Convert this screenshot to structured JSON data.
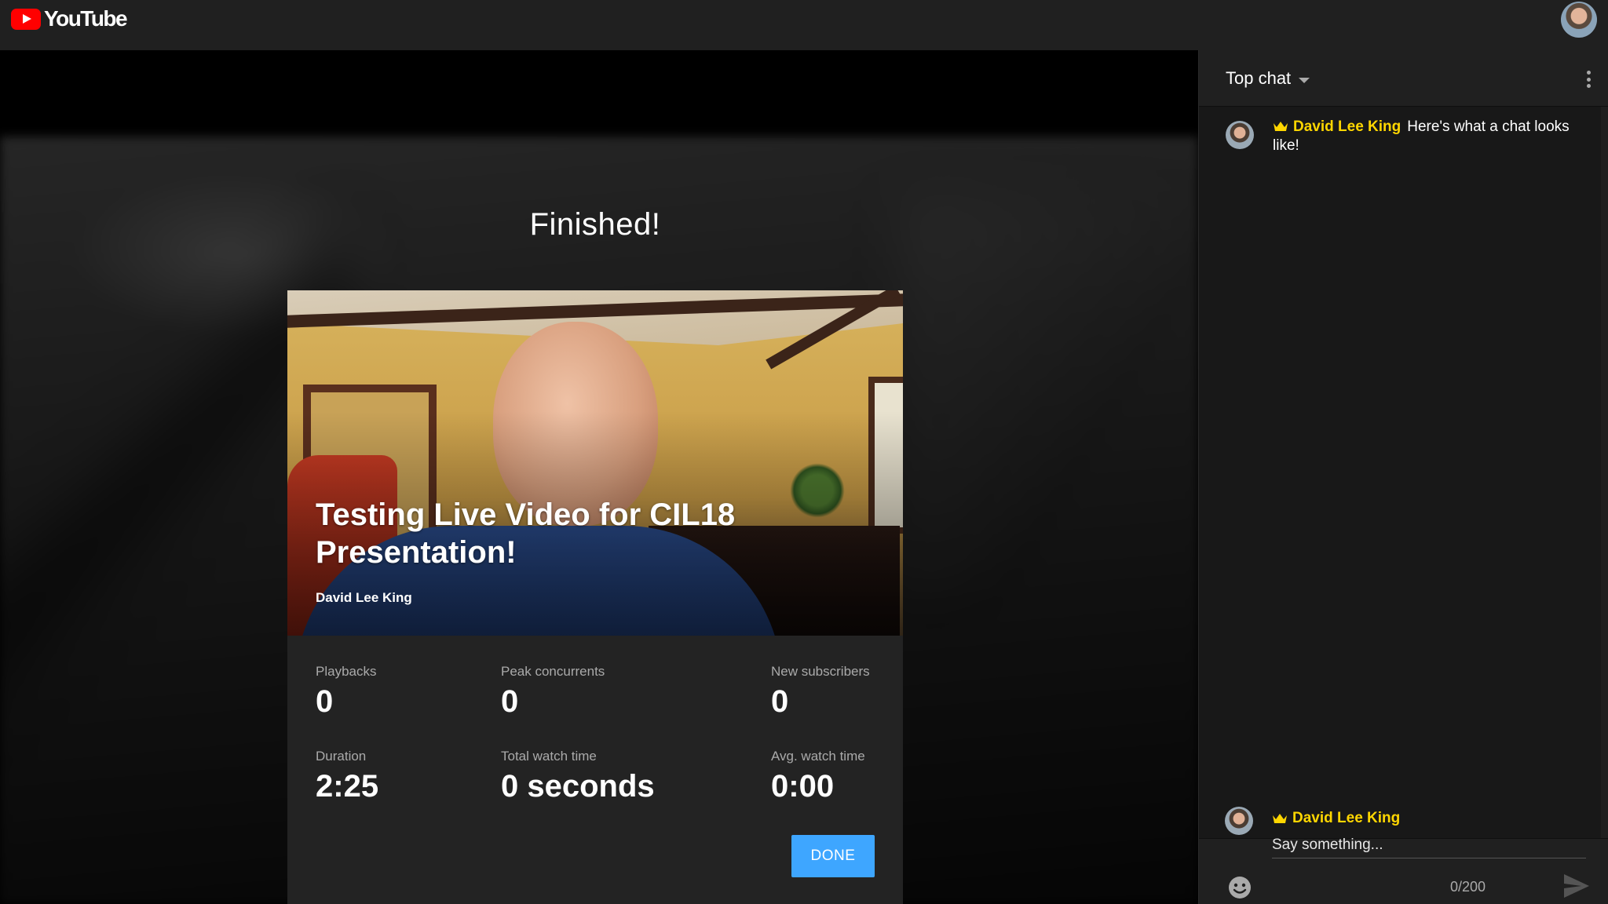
{
  "header": {
    "logo_text": "YouTube"
  },
  "summary": {
    "heading": "Finished!",
    "video_title": "Testing Live Video for CIL18 Presentation!",
    "channel_name": "David Lee King",
    "stats": [
      {
        "label": "Playbacks",
        "value": "0"
      },
      {
        "label": "Peak concurrents",
        "value": "0"
      },
      {
        "label": "New subscribers",
        "value": "0"
      },
      {
        "label": "Duration",
        "value": "2:25"
      },
      {
        "label": "Total watch time",
        "value": "0 seconds"
      },
      {
        "label": "Avg. watch time",
        "value": "0:00"
      }
    ],
    "done_label": "DONE"
  },
  "chat": {
    "mode_label": "Top chat",
    "messages": [
      {
        "author": "David Lee King",
        "text": "Here's what a chat looks like!"
      }
    ],
    "input": {
      "author": "David Lee King",
      "placeholder": "Say something...",
      "char_count": "0/200"
    }
  },
  "colors": {
    "accent": "#3ea6ff",
    "owner_name": "#ffd600",
    "brand": "#ff0000"
  },
  "icons": [
    "youtube-logo-icon",
    "avatar",
    "chevron-down-icon",
    "more-vert-icon",
    "crown-icon",
    "emoji-icon",
    "send-icon"
  ]
}
